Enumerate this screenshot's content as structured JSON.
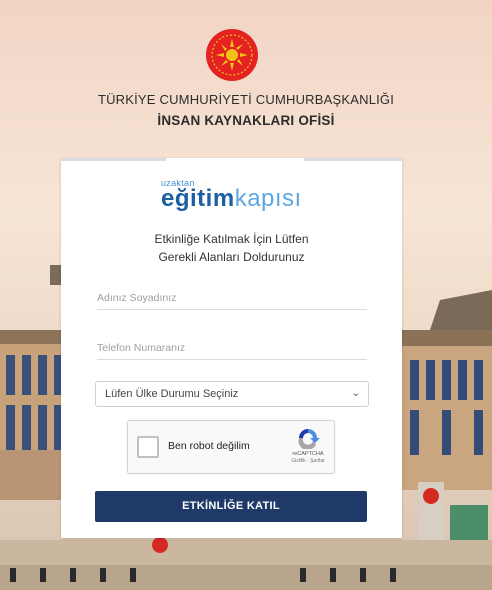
{
  "header": {
    "org_line1": "TÜRKİYE CUMHURİYETİ CUMHURBAŞKANLIĞI",
    "org_line2": "İNSAN KAYNAKLARI OFİSİ"
  },
  "logo": {
    "small": "uzaktan",
    "bold": "eğitim",
    "light": "kapısı"
  },
  "form": {
    "instruction_line1": "Etkinliğe Katılmak İçin Lütfen",
    "instruction_line2": "Gerekli Alanları Doldurunuz",
    "name_placeholder": "Adınız Soyadınız",
    "phone_placeholder": "Telefon Numaranız",
    "country_select": "Lüfen Ülke Durumu Seçiniz",
    "submit_label": "ETKİNLİĞE KATIL"
  },
  "recaptcha": {
    "label": "Ben robot değilim",
    "brand": "reCAPTCHA",
    "links": "Gizlilik - Şartlar"
  },
  "colors": {
    "button_bg": "#1f3a68",
    "emblem_red": "#e32221",
    "emblem_gold": "#f2c21b"
  },
  "icons": {
    "emblem": "presidential-seal-icon",
    "select_chevron": "chevron-down-icon",
    "recaptcha": "recaptcha-icon"
  }
}
